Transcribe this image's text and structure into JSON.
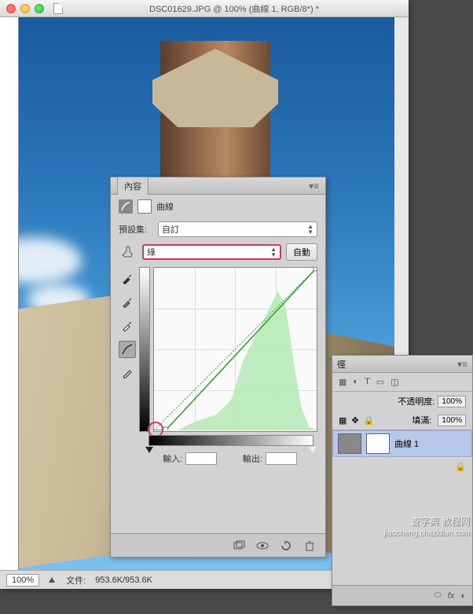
{
  "window": {
    "title": "DSC01629.JPG @ 100% (曲線 1, RGB/8*) *"
  },
  "statusbar": {
    "zoom": "100%",
    "filesize_label": "文件:",
    "filesize": "953.6K/953.6K"
  },
  "curves_panel": {
    "tab": "內容",
    "adjustment_name": "曲線",
    "preset_label": "預設集:",
    "preset_value": "自訂",
    "channel_value": "綠",
    "auto_button": "自動",
    "input_label": "輸入:",
    "output_label": "輸出:",
    "input_value": "",
    "output_value": "",
    "icons": {
      "eyedropper_black": "eyedropper-black",
      "eyedropper_gray": "eyedropper-gray",
      "eyedropper_white": "eyedropper-white",
      "curve_tool": "curve-tool",
      "pencil": "pencil"
    }
  },
  "layers_panel": {
    "tab_partial": "徑",
    "opacity_label": "不透明度:",
    "opacity_value": "100%",
    "fill_label": "填滿:",
    "fill_value": "100%",
    "layers": [
      {
        "name": "曲線 1"
      }
    ],
    "footer_fx": "fx"
  },
  "chart_data": {
    "type": "line",
    "title": "",
    "xlabel": "輸入",
    "ylabel": "輸出",
    "xlim": [
      0,
      255
    ],
    "ylim": [
      0,
      255
    ],
    "series": [
      {
        "name": "baseline",
        "x": [
          0,
          255
        ],
        "y": [
          0,
          255
        ]
      },
      {
        "name": "curve",
        "x": [
          0,
          18,
          255
        ],
        "y": [
          0,
          0,
          255
        ]
      }
    ],
    "histogram_channel": "green",
    "histogram_note": "green-channel histogram shown as background; bulk of mass roughly between input 110 and 230 with peak near 190"
  },
  "watermark": {
    "line1": "查字典 教程网",
    "line2": "jiaocheng.chazidian.com"
  }
}
